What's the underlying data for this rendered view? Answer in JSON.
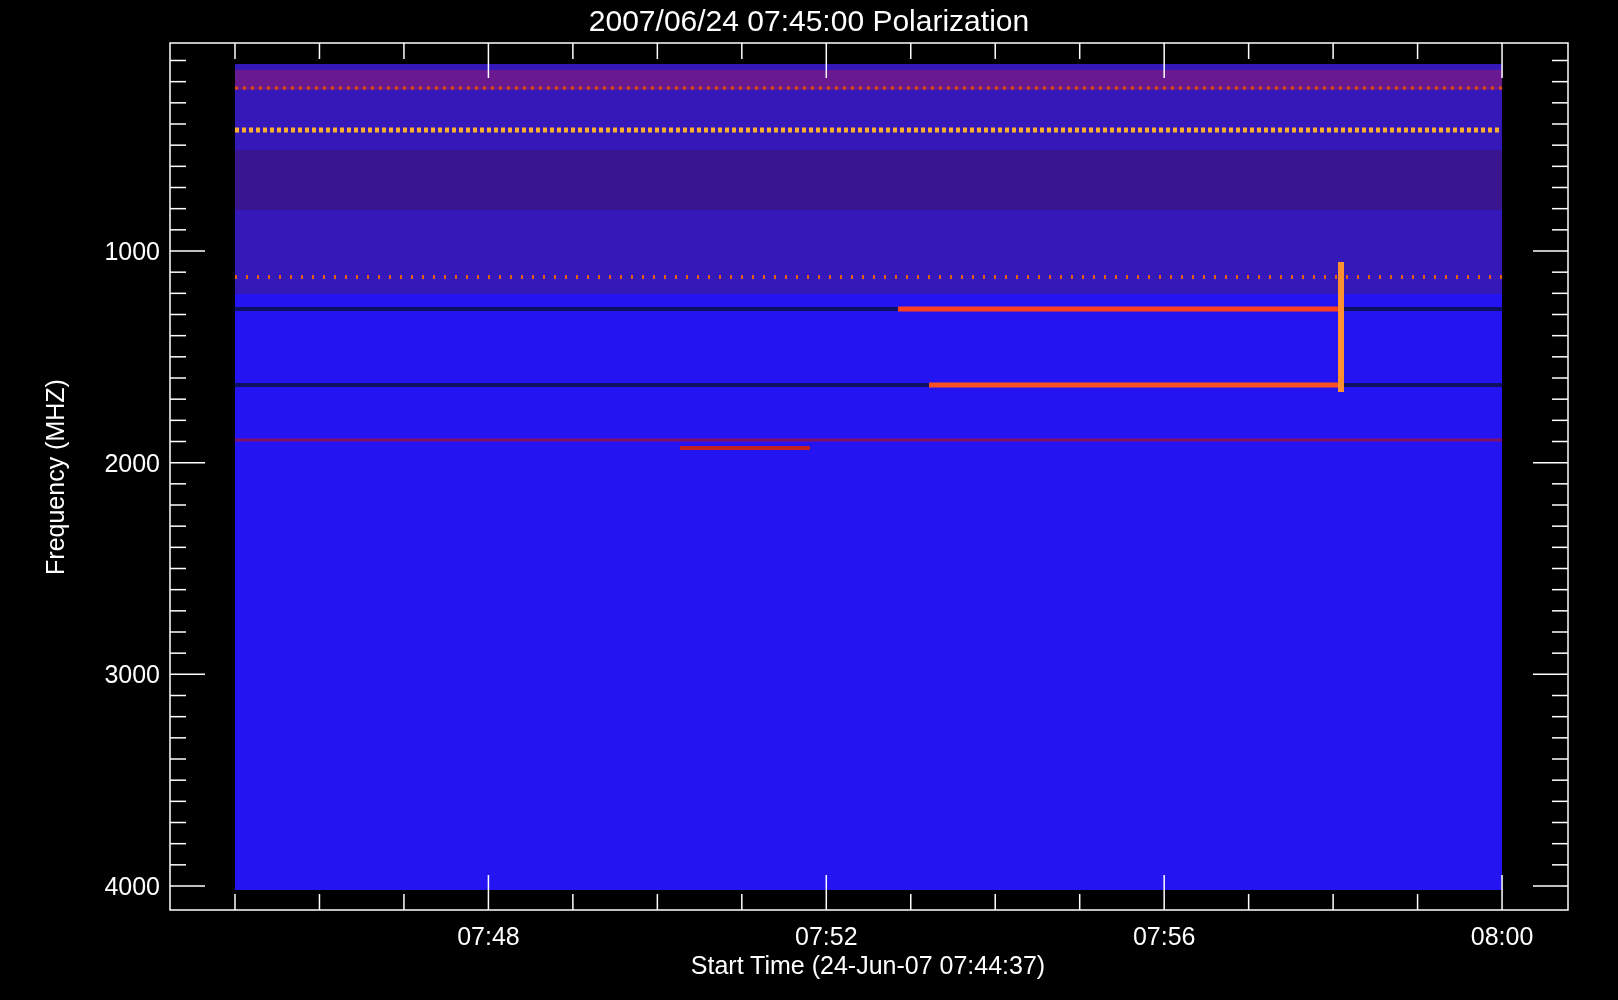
{
  "title": "2007/06/24 07:45:00 Polarization",
  "y_axis": {
    "label": "Frequency (MHZ)",
    "ticks": [
      "1000",
      "2000",
      "3000",
      "4000"
    ]
  },
  "x_axis": {
    "label": "Start Time (24-Jun-07 07:44:37)",
    "ticks": [
      "07:48",
      "07:52",
      "07:56",
      "08:00"
    ]
  }
}
